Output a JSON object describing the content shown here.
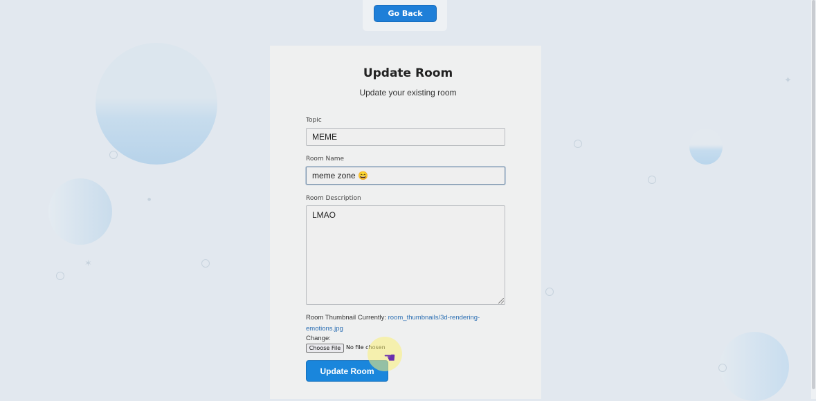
{
  "nav": {
    "go_back_label": "Go Back"
  },
  "form": {
    "title": "Update Room",
    "subtitle": "Update your existing room",
    "topic": {
      "label": "Topic",
      "value": "MEME"
    },
    "room_name": {
      "label": "Room Name",
      "value": "meme zone 😄"
    },
    "room_description": {
      "label": "Room Description",
      "value": "LMAO"
    },
    "thumbnail": {
      "label": "Room Thumbnail",
      "currently_label": "Currently:",
      "current_file_part1": "room_thumbnails/3d-rendering-",
      "current_file_part2": "emotions.jpg",
      "change_label": "Change:",
      "choose_file_label": "Choose File",
      "no_file_text": "No file chosen"
    },
    "submit_label": "Update Room"
  },
  "colors": {
    "background": "#e2e8ef",
    "card": "#eff0f0",
    "primary_button": "#1a86dc",
    "link": "#2c6fb3"
  },
  "icons": [
    "sparkle-icon",
    "resize-grip-icon",
    "hand-pointer-icon"
  ]
}
